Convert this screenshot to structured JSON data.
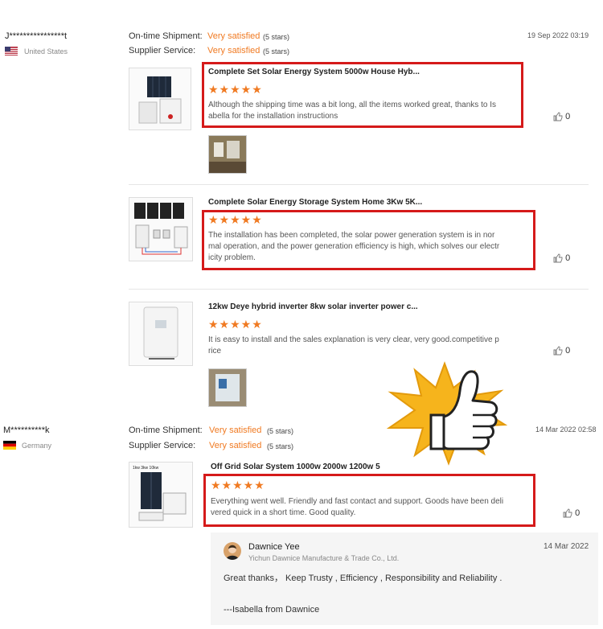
{
  "reviews": [
    {
      "reviewer": "J****************t",
      "country": "United States",
      "shipment_label": "On-time Shipment:",
      "shipment_value": "Very satisfied",
      "shipment_stars": "(5 stars)",
      "service_label": "Supplier Service:",
      "service_value": "Very satisfied",
      "service_stars": "(5 stars)",
      "date": "19 Sep 2022 03:19",
      "items": [
        {
          "title": "Complete Set Solar Energy System 5000w House Hyb...",
          "stars": "★★★★★",
          "text_lines": [
            "Although the shipping time was a bit long, all the items worked great, thanks to Is",
            "abella for the installation instructions"
          ],
          "likes": "0"
        },
        {
          "title": "Complete Solar Energy Storage System Home 3Kw 5K...",
          "stars": "★★★★★",
          "text_lines": [
            "The installation has been completed, the solar power generation system is in nor",
            "mal operation, and the power generation efficiency is high, which solves our electr",
            "icity problem."
          ],
          "likes": "0"
        },
        {
          "title": "12kw Deye hybrid inverter 8kw solar inverter power c...",
          "stars": "★★★★★",
          "text_lines": [
            "It is easy to install and the sales explanation is very clear, very good.competitive p",
            "rice"
          ],
          "likes": "0"
        }
      ]
    },
    {
      "reviewer": "M**********k",
      "country": "Germany",
      "shipment_label": "On-time Shipment:",
      "shipment_value": "Very satisfied",
      "shipment_stars": "(5 stars)",
      "service_label": "Supplier Service:",
      "service_value": "Very satisfied",
      "service_stars": "(5 stars)",
      "date": "14 Mar 2022 02:58",
      "items": [
        {
          "title": "Off Grid Solar System 1000w 2000w 1200w 5",
          "stars": "★★★★★",
          "text_lines": [
            "Everything went well. Friendly and fast contact and support. Goods have been deli",
            "vered quick in a short time. Good quality."
          ],
          "likes": "0"
        }
      ],
      "reply": {
        "name": "Dawnice Yee",
        "company": "Yichun Dawnice Manufacture & Trade Co., Ltd.",
        "date": "14 Mar 2022",
        "line1": "Great thanks，  Keep Trusty , Efficiency , Responsibility and Reliability .",
        "line2": "---Isabella from Dawnice"
      }
    }
  ],
  "product_image_labels": {
    "off_grid_banner": "1kw 3kw 10kw"
  },
  "colors": {
    "accent": "#f07a22",
    "highlight_box": "#d51a1a",
    "reply_bg": "#f5f5f5",
    "thumbs_up_burst": "#f6b41c"
  },
  "icons": {
    "like": "thumbs-up-icon",
    "sticker": "thumbs-up-sticker"
  }
}
